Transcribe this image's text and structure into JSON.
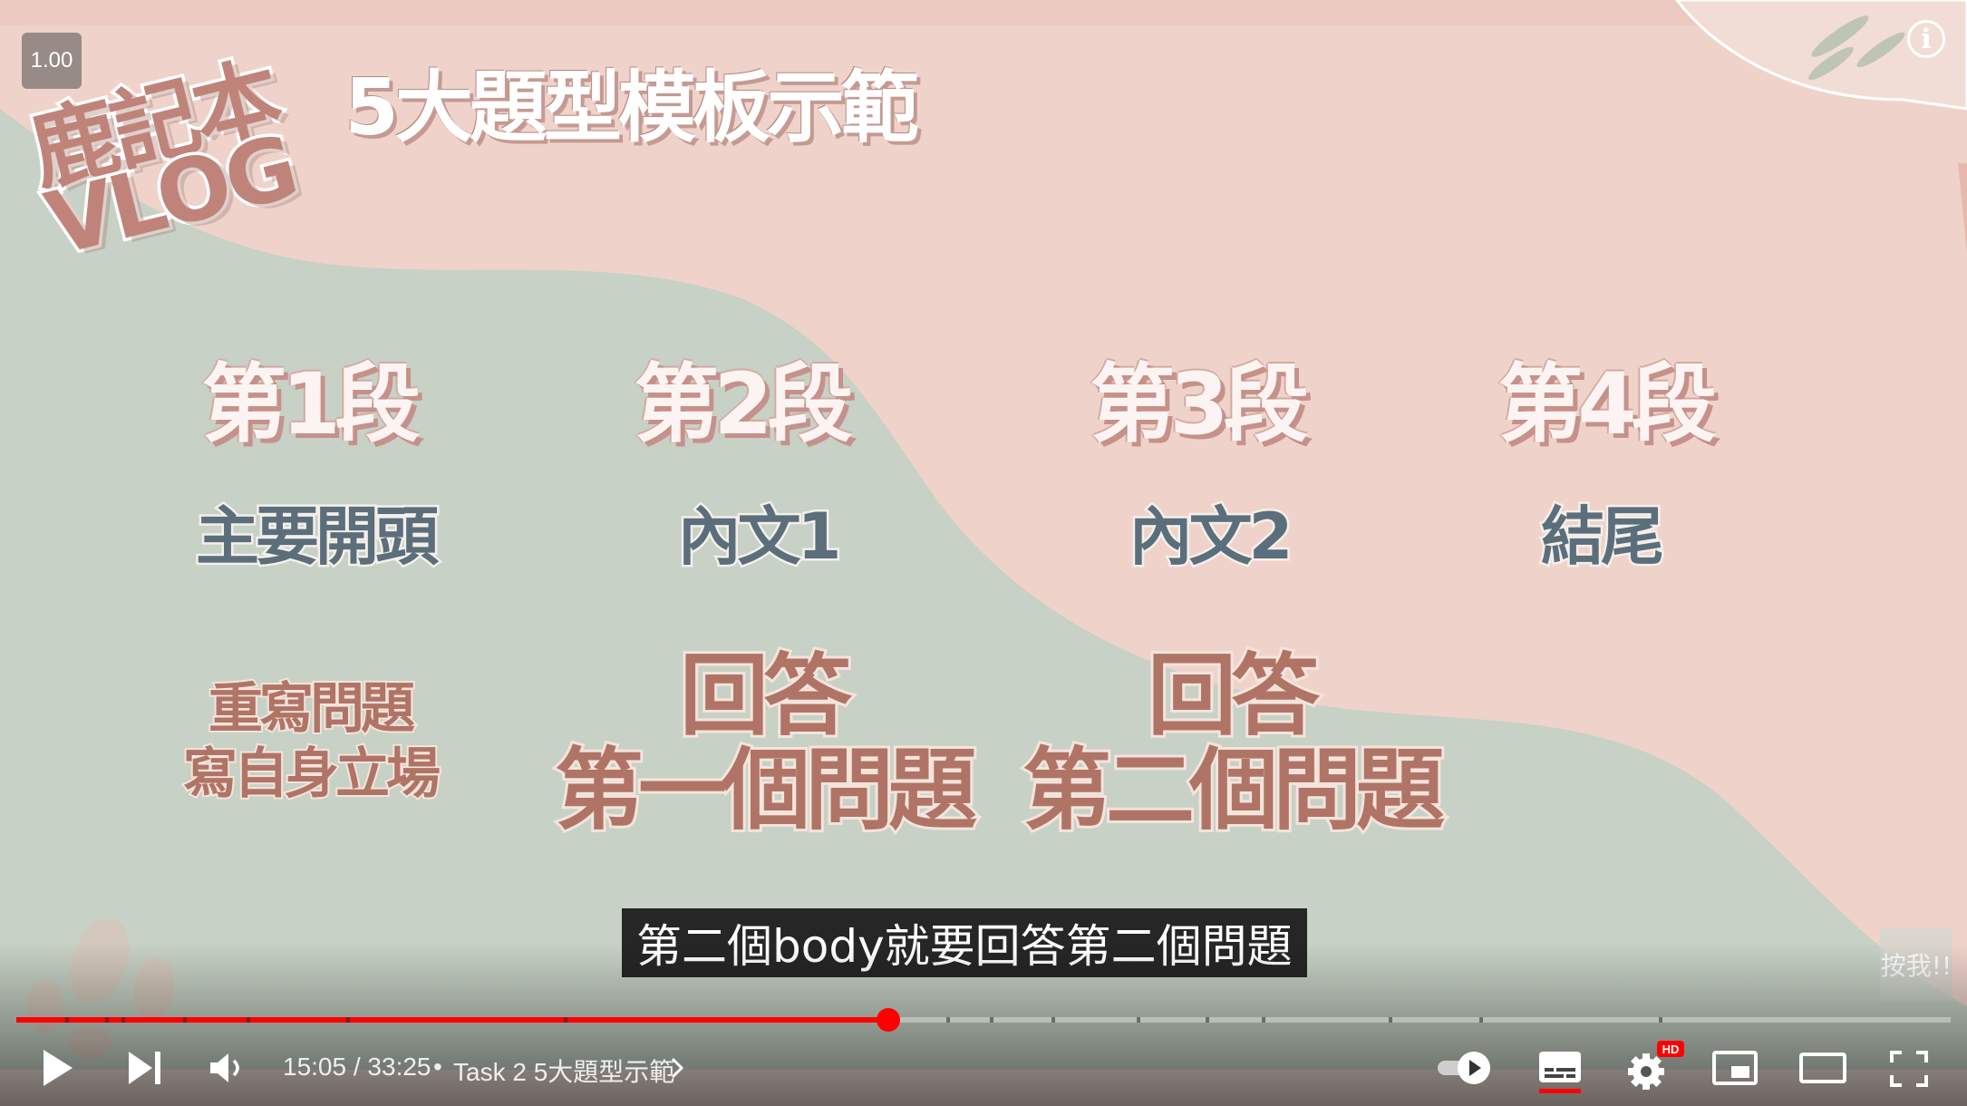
{
  "player": {
    "speed_badge": "1.00",
    "logo_line1": "鹿記本",
    "logo_line2": "VLOG",
    "title": "5大題型模板示範",
    "press_button": "按我!!",
    "caption": "第二個body就要回答第二個問題"
  },
  "slide": {
    "paragraphs": [
      {
        "heading": "第1段",
        "role": "主要開頭",
        "detail": [
          "重寫問題",
          "寫自身立場"
        ]
      },
      {
        "heading": "第2段",
        "role": "內文1",
        "detail": [
          "回答",
          "第一個問題"
        ]
      },
      {
        "heading": "第3段",
        "role": "內文2",
        "detail": [
          "回答",
          "第二個問題"
        ]
      },
      {
        "heading": "第4段",
        "role": "結尾"
      }
    ]
  },
  "controls": {
    "current_time": "15:05",
    "separator": " / ",
    "duration": "33:25",
    "chapter_bullet": "•",
    "chapter": "Task 2 5大題型示範",
    "progress_fraction": 0.451,
    "hd_badge": "HD",
    "icons": [
      "play-icon",
      "next-icon",
      "volume-icon",
      "chevron-right-icon",
      "autoplay-toggle-icon",
      "subtitles-icon",
      "settings-icon",
      "miniplayer-icon",
      "theater-icon",
      "fullscreen-icon",
      "info-icon"
    ]
  },
  "colors": {
    "progress": "#ff0000",
    "pink_bg": "#efd2ca",
    "sage_bg": "#c5d0c3",
    "subtitle_underline": "#ff0000"
  }
}
